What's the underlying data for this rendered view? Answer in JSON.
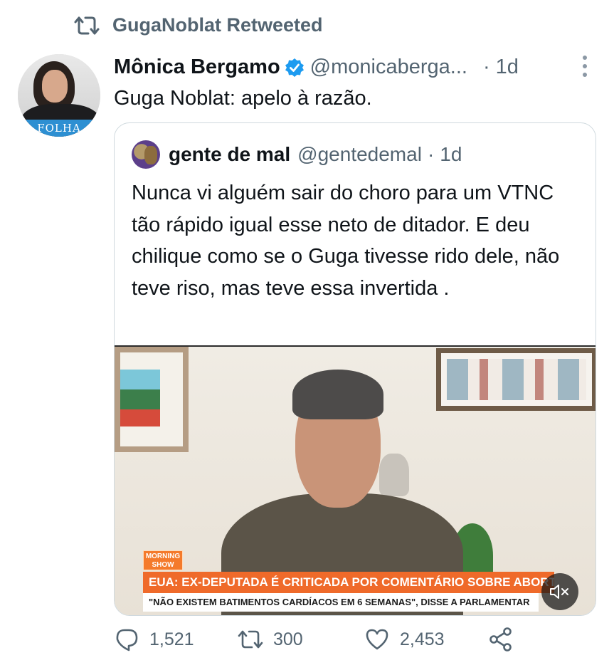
{
  "retweet_context": {
    "label": "GugaNoblat Retweeted",
    "icon": "retweet-icon"
  },
  "tweet": {
    "avatar_badge": "FOLHA",
    "author_name": "Mônica Bergamo",
    "verified": true,
    "author_handle": "@monicaberga...",
    "separator": "·",
    "time": "1d",
    "text": "Guga Noblat: apelo à razão."
  },
  "quoted_tweet": {
    "author_name": "gente de mal",
    "author_handle": "@gentedemal",
    "separator": "·",
    "time": "1d",
    "text": "Nunca vi alguém sair do choro para um VTNC tão rápido igual esse neto de ditador. E deu chilique como se o Guga tivesse rido dele, não teve riso, mas teve essa invertida ."
  },
  "video": {
    "show_logo": "MORNING SHOW",
    "headline": "EUA: EX-DEPUTADA É CRITICADA POR COMENTÁRIO SOBRE ABORTO",
    "subheadline": "\"NÃO EXISTEM BATIMENTOS CARDÍACOS EM 6 SEMANAS\", DISSE A PARLAMENTAR",
    "muted": true
  },
  "actions": {
    "replies": "1,521",
    "retweets": "300",
    "likes": "2,453"
  },
  "colors": {
    "text_primary": "#0f1419",
    "text_secondary": "#536471",
    "verified_blue": "#1d9bf0",
    "border": "#cfd9de",
    "lower_third_orange": "#ef6a2a"
  }
}
